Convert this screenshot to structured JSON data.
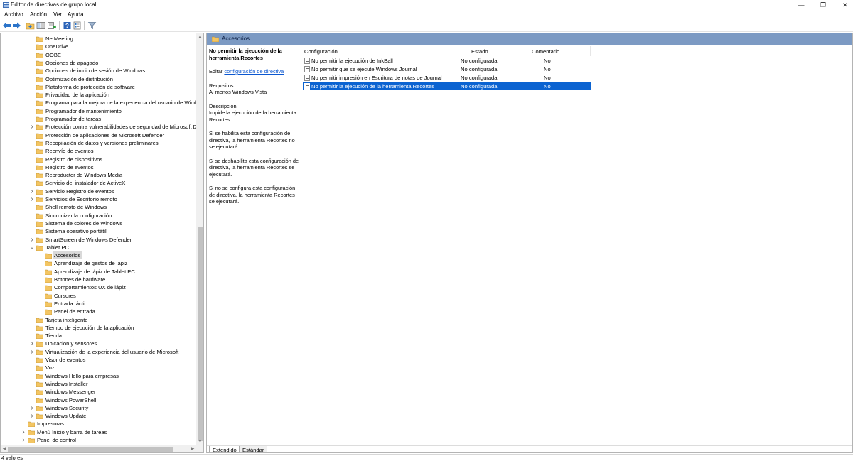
{
  "window": {
    "title": "Editor de directivas de grupo local",
    "minimize_glyph": "—",
    "maximize_glyph": "❐",
    "close_glyph": "✕"
  },
  "menu": [
    "Archivo",
    "Acción",
    "Ver",
    "Ayuda"
  ],
  "toolbar": {
    "icons": [
      "back-arrow-icon",
      "forward-arrow-icon",
      "folder-up-icon",
      "show-hide-tree-icon",
      "export-list-icon",
      "help-icon",
      "properties-icon",
      "filter-icon"
    ]
  },
  "tree": [
    {
      "label": "NetMeeting",
      "level": 1,
      "expander": false
    },
    {
      "label": "OneDrive",
      "level": 1,
      "expander": false
    },
    {
      "label": "OOBE",
      "level": 1,
      "expander": false
    },
    {
      "label": "Opciones de apagado",
      "level": 1,
      "expander": false
    },
    {
      "label": "Opciones de inicio de sesión de Windows",
      "level": 1,
      "expander": false
    },
    {
      "label": "Optimización de distribución",
      "level": 1,
      "expander": false
    },
    {
      "label": "Plataforma de protección de software",
      "level": 1,
      "expander": false
    },
    {
      "label": "Privacidad de la aplicación",
      "level": 1,
      "expander": false
    },
    {
      "label": "Programa para la mejora de la experiencia del usuario de Windo",
      "level": 1,
      "expander": false
    },
    {
      "label": "Programador de mantenimiento",
      "level": 1,
      "expander": false
    },
    {
      "label": "Programador de tareas",
      "level": 1,
      "expander": false
    },
    {
      "label": "Protección contra vulnerabilidades de seguridad de Microsoft De",
      "level": 1,
      "expander": "collapsed"
    },
    {
      "label": "Protección de aplicaciones de Microsoft Defender",
      "level": 1,
      "expander": false
    },
    {
      "label": "Recopilación de datos y versiones preliminares",
      "level": 1,
      "expander": false
    },
    {
      "label": "Reenvío de eventos",
      "level": 1,
      "expander": false
    },
    {
      "label": "Registro de dispositivos",
      "level": 1,
      "expander": false
    },
    {
      "label": "Registro de eventos",
      "level": 1,
      "expander": false
    },
    {
      "label": "Reproductor de Windows Media",
      "level": 1,
      "expander": false
    },
    {
      "label": "Servicio del instalador de ActiveX",
      "level": 1,
      "expander": false
    },
    {
      "label": "Servicio Registro de eventos",
      "level": 1,
      "expander": "collapsed"
    },
    {
      "label": "Servicios de Escritorio remoto",
      "level": 1,
      "expander": "collapsed"
    },
    {
      "label": "Shell remoto de Windows",
      "level": 1,
      "expander": false
    },
    {
      "label": "Sincronizar la configuración",
      "level": 1,
      "expander": false
    },
    {
      "label": "Sistema de colores de Windows",
      "level": 1,
      "expander": false
    },
    {
      "label": "Sistema operativo portátil",
      "level": 1,
      "expander": false
    },
    {
      "label": "SmartScreen de Windows Defender",
      "level": 1,
      "expander": "collapsed"
    },
    {
      "label": "Tablet PC",
      "level": 1,
      "expander": "expanded"
    },
    {
      "label": "Accesorios",
      "level": 2,
      "expander": false,
      "selected": true
    },
    {
      "label": "Aprendizaje de gestos de lápiz",
      "level": 2,
      "expander": false
    },
    {
      "label": "Aprendizaje de lápiz de Tablet PC",
      "level": 2,
      "expander": false
    },
    {
      "label": "Botones de hardware",
      "level": 2,
      "expander": false
    },
    {
      "label": "Comportamientos UX de lápiz",
      "level": 2,
      "expander": false
    },
    {
      "label": "Cursores",
      "level": 2,
      "expander": false
    },
    {
      "label": "Entrada táctil",
      "level": 2,
      "expander": false
    },
    {
      "label": "Panel de entrada",
      "level": 2,
      "expander": false
    },
    {
      "label": "Tarjeta inteligente",
      "level": 1,
      "expander": false
    },
    {
      "label": "Tiempo de ejecución de la aplicación",
      "level": 1,
      "expander": false
    },
    {
      "label": "Tienda",
      "level": 1,
      "expander": false
    },
    {
      "label": "Ubicación y sensores",
      "level": 1,
      "expander": "collapsed"
    },
    {
      "label": "Virtualización de la experiencia del usuario de Microsoft",
      "level": 1,
      "expander": "collapsed"
    },
    {
      "label": "Visor de eventos",
      "level": 1,
      "expander": false
    },
    {
      "label": "Voz",
      "level": 1,
      "expander": false
    },
    {
      "label": "Windows Hello para empresas",
      "level": 1,
      "expander": false
    },
    {
      "label": "Windows Installer",
      "level": 1,
      "expander": false
    },
    {
      "label": "Windows Messenger",
      "level": 1,
      "expander": false
    },
    {
      "label": "Windows PowerShell",
      "level": 1,
      "expander": false
    },
    {
      "label": "Windows Security",
      "level": 1,
      "expander": "collapsed"
    },
    {
      "label": "Windows Update",
      "level": 1,
      "expander": "collapsed"
    },
    {
      "label": "Impresoras",
      "level": 0,
      "expander": false
    },
    {
      "label": "Menú Inicio y barra de tareas",
      "level": 0,
      "expander": "collapsed"
    },
    {
      "label": "Panel de control",
      "level": 0,
      "expander": "collapsed"
    }
  ],
  "content": {
    "header": "Accesorios",
    "description": {
      "title": "No permitir la ejecución de la herramienta Recortes",
      "edit_prefix": "Editar",
      "edit_link": "configuración de directiva",
      "requirements_label": "Requisitos:",
      "requirements_value": "Al menos Windows Vista",
      "description_label": "Descripción:",
      "description_value": "Impide la ejecución de la herramienta Recortes.",
      "enabled_text": "Si se habilita esta configuración de directiva, la herramienta Recortes no se ejecutará.",
      "disabled_text": "Si se deshabilita esta configuración de directiva, la herramienta Recortes se ejecutará.",
      "notconfigured_text": "Si no se configura esta configuración de directiva, la herramienta Recortes se ejecutará."
    },
    "columns": [
      "Configuración",
      "Estado",
      "Comentario"
    ],
    "rows": [
      {
        "name": "No permitir la ejecución de InkBall",
        "state": "No configurada",
        "comment": "No"
      },
      {
        "name": "No permitir que se ejecute Windows Journal",
        "state": "No configurada",
        "comment": "No"
      },
      {
        "name": "No permitir impresión en Escritura de notas de Journal",
        "state": "No configurada",
        "comment": "No"
      },
      {
        "name": "No permitir la ejecución de la herramienta Recortes",
        "state": "No configurada",
        "comment": "No",
        "selected": true
      }
    ],
    "tabs": [
      "Extendido",
      "Estándar"
    ]
  },
  "status": "4 valores",
  "colors": {
    "header_bg": "#7c9ac3",
    "selection": "#0b63d1",
    "folder": "#f3c562",
    "link": "#0b57d0"
  }
}
